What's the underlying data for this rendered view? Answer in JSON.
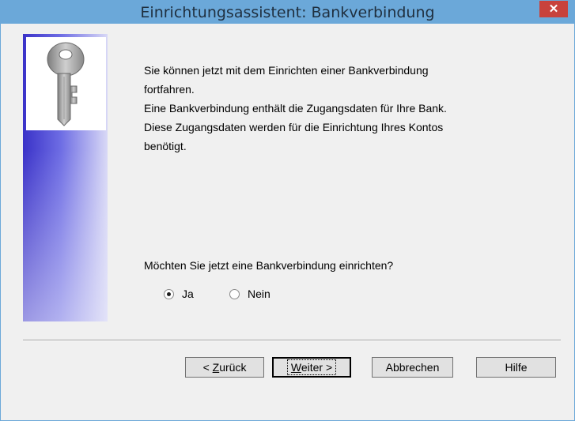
{
  "window": {
    "title": "Einrichtungsassistent: Bankverbindung",
    "close_glyph": "✕"
  },
  "icon": "key-icon",
  "body_lines": [
    "Sie können jetzt mit dem Einrichten einer Bankverbindung",
    "fortfahren.",
    "Eine Bankverbindung enthält die Zugangsdaten für Ihre Bank.",
    "Diese Zugangsdaten werden für die Einrichtung Ihres Kontos",
    "benötigt."
  ],
  "question": "Möchten Sie jetzt eine Bankverbindung einrichten?",
  "options": {
    "yes_label": "Ja",
    "no_label": "Nein",
    "selected": "Ja"
  },
  "buttons": {
    "back_prefix": "< ",
    "back_mnemonic": "Z",
    "back_rest": "urück",
    "next_mnemonic": "W",
    "next_rest": "eiter >",
    "cancel": "Abbrechen",
    "help": "Hilfe"
  },
  "colors": {
    "titlebar": "#6ba8d9",
    "close": "#c8423c",
    "panel_start": "#3a32c8",
    "panel_end": "#d9d9f6"
  }
}
